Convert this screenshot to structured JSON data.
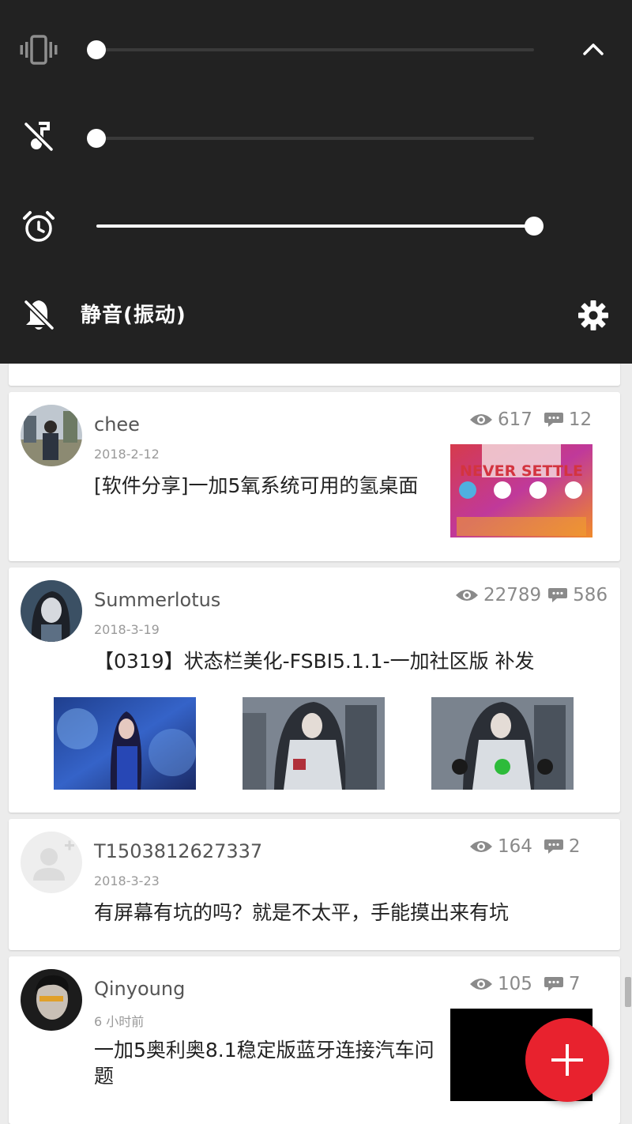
{
  "volume_panel": {
    "ring_level": 0,
    "media_level": 0,
    "alarm_level": 1,
    "mode_label": "静音(振动)",
    "icons": {
      "ring": "vibrate-icon",
      "media": "music-off-icon",
      "alarm": "alarm-clock-icon",
      "mode": "bell-off-icon",
      "collapse": "chevron-up-icon",
      "settings": "gear-icon"
    }
  },
  "posts": [
    {
      "username": "chee",
      "date": "2018-2-12",
      "title": "[软件分享]一加5氧系统可用的氢桌面",
      "views": "617",
      "comments": "12",
      "thumbnail_text": "NEVER SETTLE"
    },
    {
      "username": "Summerlotus",
      "date": "2018-3-19",
      "title": "【0319】状态栏美化-FSBI5.1.1-一加社区版 补发",
      "views": "22789",
      "comments": "586"
    },
    {
      "username": "T1503812627337",
      "date": "2018-3-23",
      "title": "有屏幕有坑的吗？就是不太平，手能摸出来有坑",
      "views": "164",
      "comments": "2"
    },
    {
      "username": "Qinyoung",
      "date": "6 小时前",
      "title": "一加5奥利奥8.1稳定版蓝牙连接汽车问题",
      "views": "105",
      "comments": "7"
    }
  ],
  "fab_icon": "plus-icon",
  "colors": {
    "panel_bg": "#222222",
    "accent_red": "#e8222e",
    "card_bg": "#ffffff",
    "page_bg": "#ececec"
  }
}
